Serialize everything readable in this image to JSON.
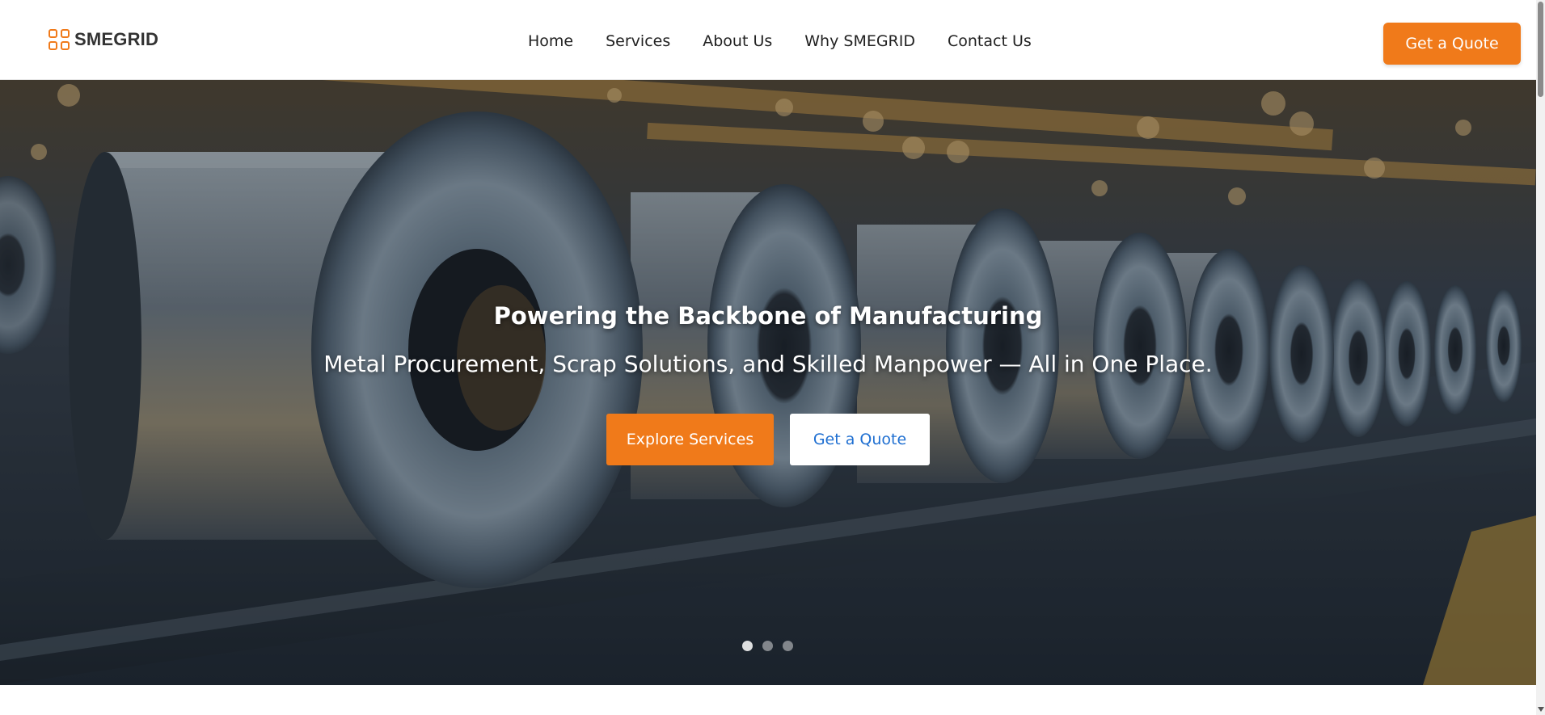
{
  "brand": {
    "name": "SMEGRID",
    "accent_color": "#f07a1a",
    "link_color": "#1f6fd1"
  },
  "nav": {
    "items": [
      {
        "label": "Home"
      },
      {
        "label": "Services"
      },
      {
        "label": "About Us"
      },
      {
        "label": "Why SMEGRID"
      },
      {
        "label": "Contact Us"
      }
    ],
    "cta_label": "Get a Quote"
  },
  "hero": {
    "title": "Powering the Backbone of Manufacturing",
    "subtitle": "Metal Procurement, Scrap Solutions, and Skilled Manpower — All in One Place.",
    "primary_button": "Explore Services",
    "secondary_button": "Get a Quote",
    "background_image": "steel-coils-factory-image",
    "carousel": {
      "slide_count": 3,
      "active_index": 0
    }
  }
}
